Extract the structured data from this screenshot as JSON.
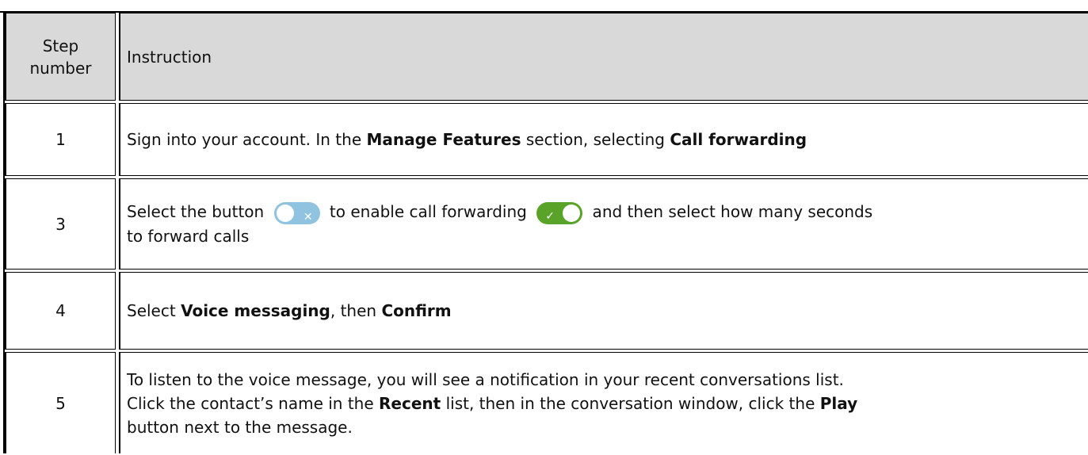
{
  "table": {
    "header": {
      "step": [
        "Step",
        "number"
      ],
      "instruction": "Instruction"
    },
    "rows": [
      {
        "step": "1",
        "segments": [
          "Sign into your account. In the ",
          "Manage Features",
          " section, selecting ",
          "Call forwarding"
        ]
      },
      {
        "step": "3",
        "segments": [
          "Select the button ",
          " to enable call forwarding ",
          " and then select how many seconds",
          "to forward calls"
        ],
        "toggles": {
          "off_icon": "toggle-off-icon",
          "on_icon": "toggle-on-icon"
        }
      },
      {
        "step": "4",
        "segments": [
          "Select ",
          "Voice messaging",
          ", then ",
          "Confirm"
        ]
      },
      {
        "step": "5",
        "lines": [
          [
            "To listen to the voice message, you will see a notification in your recent conversations list."
          ],
          [
            "Click the contact’s name in the ",
            "Recent",
            " list, then in the conversation window, click the ",
            "Play"
          ],
          [
            "button next to the message."
          ]
        ]
      }
    ]
  },
  "colors": {
    "header_bg": "#d9d9d9",
    "toggle_off": "#8fc3e0",
    "toggle_on": "#5aa329"
  }
}
